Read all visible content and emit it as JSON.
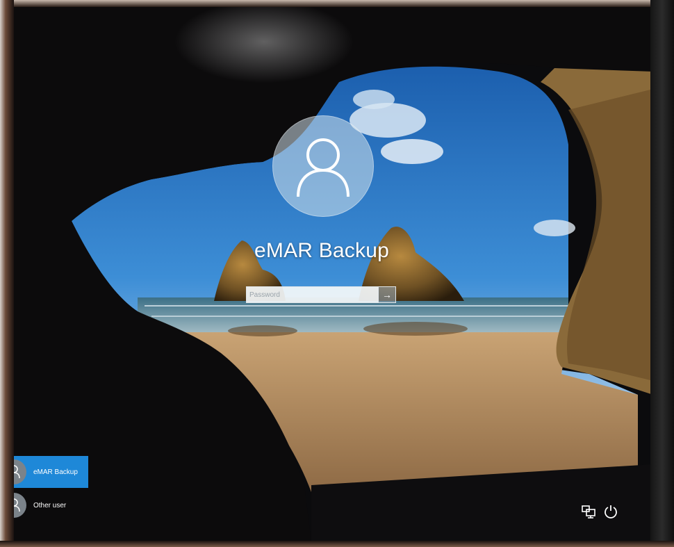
{
  "login": {
    "user_name": "eMAR Backup",
    "password_placeholder": "Password",
    "submit_symbol": "→"
  },
  "user_list": [
    {
      "label": "eMAR Backup",
      "selected": true,
      "icon": "user-avatar-icon"
    },
    {
      "label": "Other user",
      "selected": false,
      "icon": "user-avatar-icon"
    }
  ],
  "tray": {
    "network_icon": "network-icon",
    "power_icon": "power-icon"
  },
  "colors": {
    "selected_user": "#1e88d8",
    "sky": "#2f78c4",
    "sand": "#b58b5c"
  }
}
